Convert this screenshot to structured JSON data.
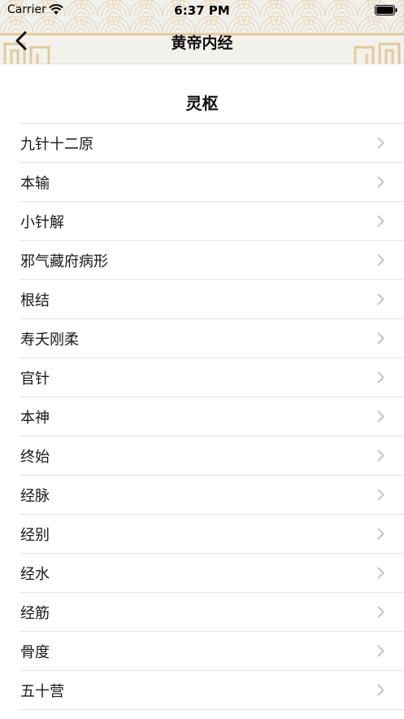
{
  "status_bar": {
    "carrier": "Carrier",
    "time": "6:37 PM"
  },
  "nav": {
    "title": "黄帝内经",
    "back_icon": "chevron-left-icon"
  },
  "section": {
    "title": "灵枢"
  },
  "items": [
    {
      "label": "九针十二原"
    },
    {
      "label": "本输"
    },
    {
      "label": "小针解"
    },
    {
      "label": "邪气藏府病形"
    },
    {
      "label": "根结"
    },
    {
      "label": "寿夭刚柔"
    },
    {
      "label": "官针"
    },
    {
      "label": "本神"
    },
    {
      "label": "终始"
    },
    {
      "label": "经脉"
    },
    {
      "label": "经别"
    },
    {
      "label": "经水"
    },
    {
      "label": "经筋"
    },
    {
      "label": "骨度"
    },
    {
      "label": "五十营"
    }
  ],
  "colors": {
    "header_bg": "#f3f1ec",
    "pattern_stroke": "#e0d2b6",
    "frame_gold": "#e2c99c",
    "separator": "#e4e4e4",
    "chevron": "#c4c4c7"
  }
}
